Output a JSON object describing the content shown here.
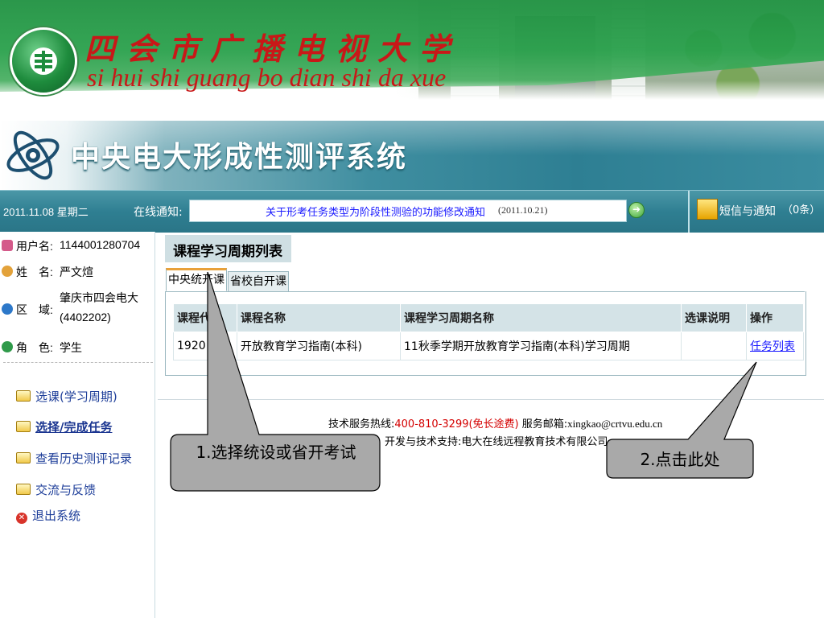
{
  "banner": {
    "university_cn": "四会市广播电视大学",
    "university_pinyin": "si hui shi guang bo dian shi da xue"
  },
  "system": {
    "title": "中央电大形成性测评系统"
  },
  "status_bar": {
    "date": "2011.11.08 星期二",
    "notice_label": "在线通知:",
    "notice_text": "关于形考任务类型为阶段性测验的功能修改通知",
    "notice_date": "(2011.10.21)",
    "messages_label": "短信与通知",
    "messages_count": "（0条）"
  },
  "user_info": {
    "username_label": "用户名:",
    "username": "1144001280704",
    "name_label": "姓　名:",
    "name": "严文煊",
    "region_label": "区　域:",
    "region_line1": "肇庆市四会电大",
    "region_line2": "(4402202)",
    "role_label": "角　色:",
    "role": "学生"
  },
  "nav": [
    {
      "label": "选课(学习周期)"
    },
    {
      "label": "选择/完成任务"
    },
    {
      "label": "查看历史测评记录"
    },
    {
      "label": "交流与反馈"
    },
    {
      "label": "退出系统"
    }
  ],
  "main": {
    "panel_title": "课程学习周期列表",
    "tabs": [
      {
        "label": "中央统开课"
      },
      {
        "label": "省校自开课"
      }
    ],
    "table": {
      "headers": [
        "课程代",
        "课程名称",
        "课程学习周期名称",
        "选课说明",
        "操作"
      ],
      "rows": [
        {
          "code": "1920",
          "name": "开放教育学习指南(本科)",
          "period": "11秋季学期开放教育学习指南(本科)学习周期",
          "note": "",
          "action": "任务列表"
        }
      ]
    }
  },
  "footer": {
    "hotline_label": "技术服务热线:",
    "hotline": "400-810-3299",
    "hotline_note": "(免长途费)",
    "email_label": "服务邮箱:",
    "email": "xingkao@crtvu.edu.cn",
    "support": "开发与技术支持:电大在线远程教育技术有限公司"
  },
  "callouts": {
    "callout1": "1.选择统设或省开考试",
    "callout2": "2.点击此处"
  }
}
